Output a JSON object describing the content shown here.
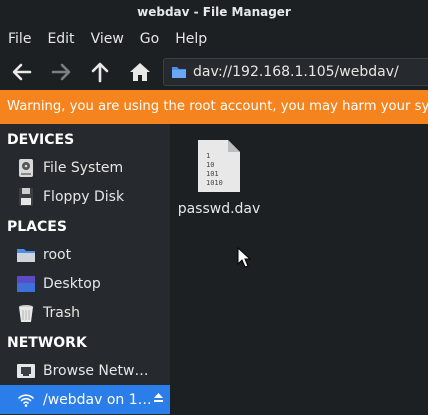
{
  "window": {
    "title": "webdav - File Manager"
  },
  "menubar": {
    "items": [
      "File",
      "Edit",
      "View",
      "Go",
      "Help"
    ]
  },
  "toolbar": {
    "back_icon": "arrow-left-icon",
    "forward_icon": "arrow-right-icon",
    "up_icon": "arrow-up-icon",
    "home_icon": "home-icon",
    "location": "dav://192.168.1.105/webdav/"
  },
  "warning": {
    "text": "Warning, you are using the root account, you may harm your system."
  },
  "sidebar": {
    "sections": [
      {
        "header": "DEVICES",
        "items": [
          {
            "label": "File System",
            "icon": "harddisk-icon"
          },
          {
            "label": "Floppy Disk",
            "icon": "floppy-icon"
          }
        ]
      },
      {
        "header": "PLACES",
        "items": [
          {
            "label": "root",
            "icon": "folder-icon"
          },
          {
            "label": "Desktop",
            "icon": "desktop-icon"
          },
          {
            "label": "Trash",
            "icon": "trash-icon"
          }
        ]
      },
      {
        "header": "NETWORK",
        "items": [
          {
            "label": "Browse Netw…",
            "icon": "network-icon"
          },
          {
            "label": "/webdav on 1…",
            "icon": "wifi-icon",
            "selected": true
          }
        ]
      }
    ]
  },
  "content": {
    "files": [
      {
        "name": "passwd.dav",
        "icon": "binary-file-icon"
      }
    ]
  },
  "colors": {
    "accent": "#2b7de9",
    "warning": "#f5841f",
    "background": "#1d2023",
    "sidebar": "#262a2e"
  }
}
